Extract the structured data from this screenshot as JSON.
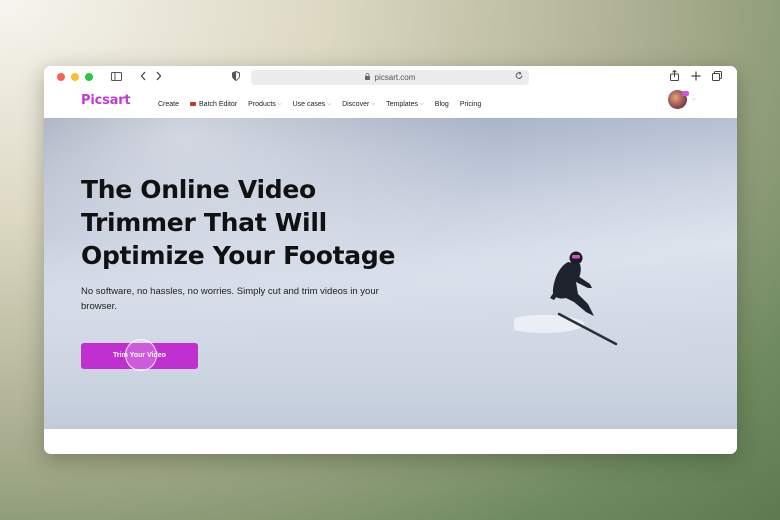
{
  "browser": {
    "url": "picsart.com",
    "icons": {
      "sidebar": "sidebar-icon",
      "back": "chevron-left-icon",
      "forward": "chevron-right-icon",
      "shield": "shield-icon",
      "lock": "lock-icon",
      "reload": "reload-icon",
      "share": "share-icon",
      "new_tab": "plus-icon",
      "tabs": "tabs-overview-icon"
    }
  },
  "nav": {
    "logo": "Picsart",
    "items": [
      {
        "label": "Create",
        "has_dropdown": false
      },
      {
        "label": "Batch Editor",
        "has_dropdown": false
      },
      {
        "label": "Products",
        "has_dropdown": true
      },
      {
        "label": "Use cases",
        "has_dropdown": true
      },
      {
        "label": "Discover",
        "has_dropdown": true
      },
      {
        "label": "Templates",
        "has_dropdown": true
      },
      {
        "label": "Blog",
        "has_dropdown": false
      },
      {
        "label": "Pricing",
        "has_dropdown": false
      }
    ]
  },
  "hero": {
    "title": "The Online Video Trimmer That Will Optimize Your Footage",
    "subtitle": "No software, no hassles, no worries. Simply cut and trim videos in your browser.",
    "cta": "Trim Your Video"
  },
  "colors": {
    "brand": "#c13ad6",
    "cta_bg": "#c02fd0"
  }
}
